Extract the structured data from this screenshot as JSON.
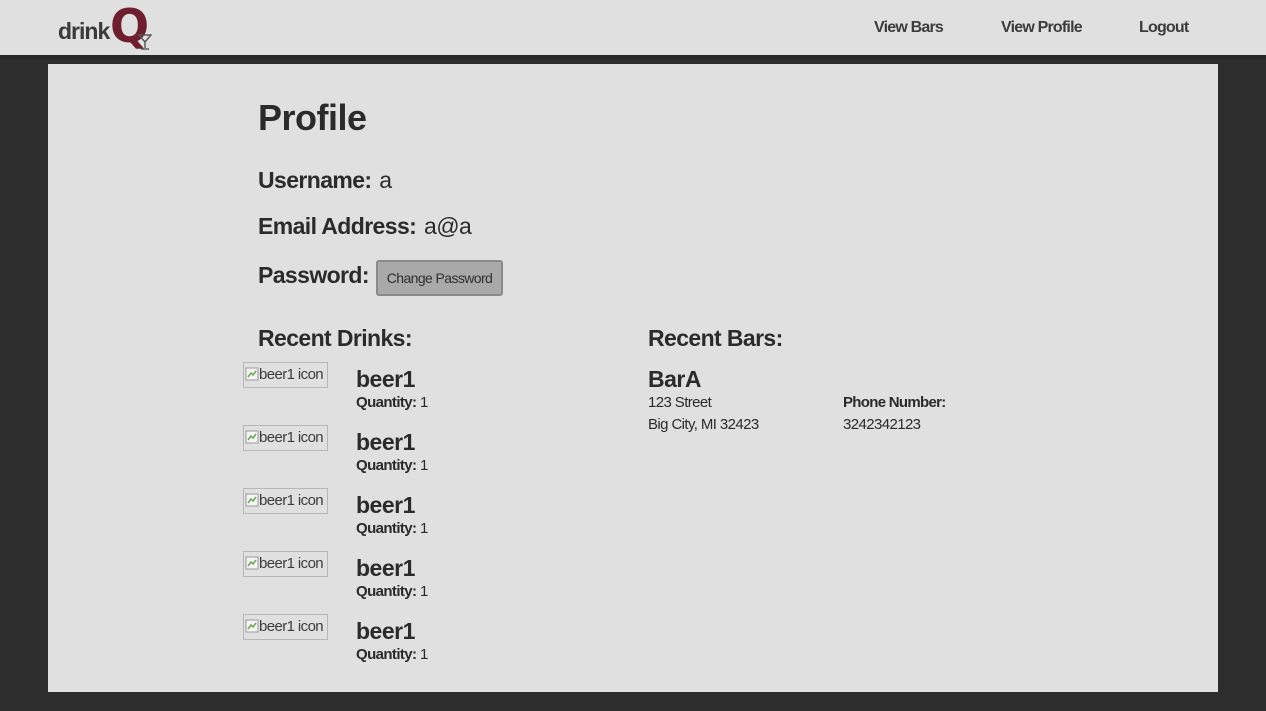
{
  "nav": {
    "logo_text": "drink",
    "logo_q": "Q",
    "view_bars": "View Bars",
    "view_profile": "View Profile",
    "logout": "Logout"
  },
  "profile": {
    "title": "Profile",
    "username_label": "Username:",
    "username": "a",
    "email_label": "Email Address:",
    "email": "a@a",
    "password_label": "Password:",
    "change_password": "Change Password"
  },
  "drinks": {
    "title": "Recent Drinks:",
    "items": [
      {
        "img_alt": "beer1 icon",
        "name": "beer1",
        "qty_label": "Quantity:",
        "qty": "1"
      },
      {
        "img_alt": "beer1 icon",
        "name": "beer1",
        "qty_label": "Quantity:",
        "qty": "1"
      },
      {
        "img_alt": "beer1 icon",
        "name": "beer1",
        "qty_label": "Quantity:",
        "qty": "1"
      },
      {
        "img_alt": "beer1 icon",
        "name": "beer1",
        "qty_label": "Quantity:",
        "qty": "1"
      },
      {
        "img_alt": "beer1 icon",
        "name": "beer1",
        "qty_label": "Quantity:",
        "qty": "1"
      }
    ]
  },
  "bars": {
    "title": "Recent Bars:",
    "items": [
      {
        "name": "BarA",
        "address_line1": "123 Street",
        "address_line2": "Big City, MI 32423",
        "phone_label": "Phone Number:",
        "phone": "3242342123"
      }
    ]
  },
  "colors": {
    "brand": "#6e1e2e",
    "background": "#2d2d2d",
    "panel": "#e0e0e0"
  }
}
